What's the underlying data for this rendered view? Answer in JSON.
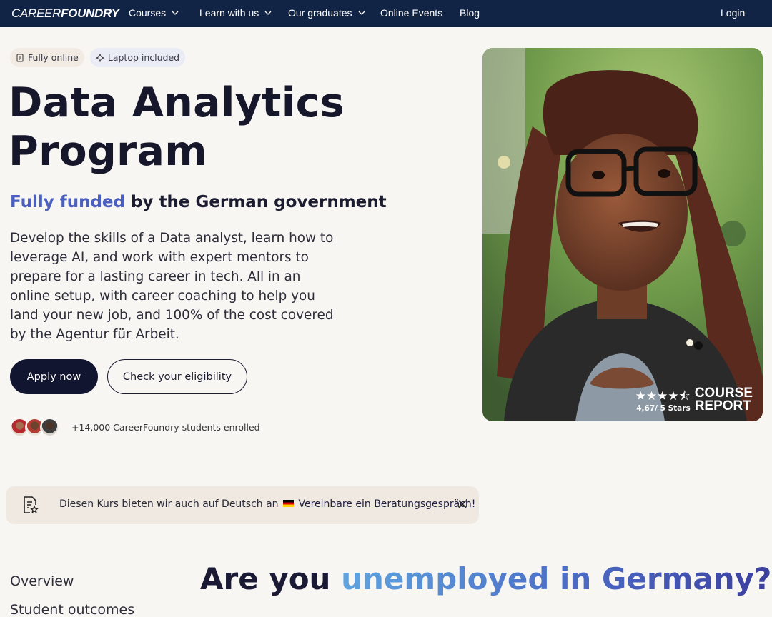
{
  "nav": {
    "logo_thin": "CAREER",
    "logo_bold": "FOUNDRY",
    "items": [
      {
        "label": "Courses",
        "dropdown": true
      },
      {
        "label": "Learn with us",
        "dropdown": true
      },
      {
        "label": "Our graduates",
        "dropdown": true
      },
      {
        "label": "Online Events",
        "dropdown": false
      },
      {
        "label": "Blog",
        "dropdown": false
      }
    ],
    "login": "Login"
  },
  "hero": {
    "badges": [
      {
        "label": "Fully online",
        "icon": "document-icon"
      },
      {
        "label": "Laptop included",
        "icon": "sparkle-icon"
      }
    ],
    "title_line1": "Data Analytics",
    "title_line2": "Program",
    "subtitle_accent": "Fully funded",
    "subtitle_rest": " by the German government",
    "description": "Develop the skills of a Data analyst, learn how to leverage AI, and work with expert mentors to prepare for a lasting career in tech. All in an online setup, with career coaching to help you land your new job, and 100% of the cost covered by the Agentur für Arbeit.",
    "apply_label": "Apply now",
    "eligibility_label": "Check your eligibility",
    "enrolled_text": "+14,000 CareerFoundry students enrolled",
    "course_report": {
      "stars": "★★★★⯪",
      "score": "4,67/ 5 Stars",
      "logo_line1": "COURSE",
      "logo_line2": "REPORT"
    }
  },
  "banner": {
    "text": "Diesen Kurs bieten wir auch auf Deutsch an",
    "link": "Vereinbare ein Beratungsgespräch!"
  },
  "section_nav": {
    "items": [
      "Overview",
      "Student outcomes"
    ]
  },
  "section": {
    "heading_pre": "Are you ",
    "heading_accent": "unemployed in Germany?"
  },
  "colors": {
    "nav_bg": "#112446",
    "accent_blue": "#4a5fc0",
    "primary_button": "#121530",
    "page_bg": "#f8f6f3"
  }
}
